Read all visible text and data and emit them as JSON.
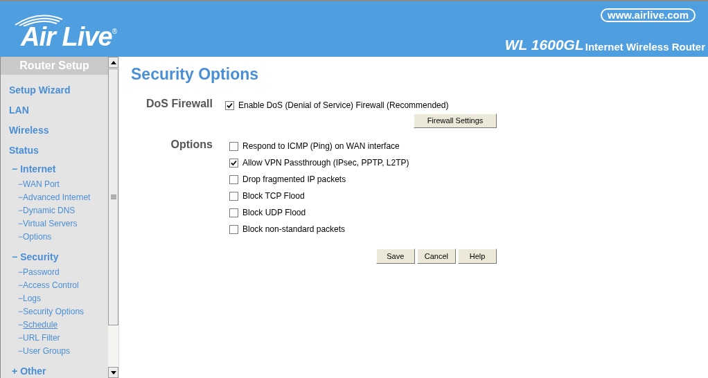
{
  "header": {
    "logo": "Air Live",
    "registered": "®",
    "website": "www.airlive.com",
    "model": "WL 1600GL",
    "product": "Internet Wireless Router"
  },
  "sidebar": {
    "title": "Router Setup",
    "items": [
      {
        "kind": "link",
        "label": "Setup Wizard"
      },
      {
        "kind": "link",
        "label": "LAN"
      },
      {
        "kind": "link",
        "label": "Wireless"
      },
      {
        "kind": "link",
        "label": "Status"
      },
      {
        "kind": "group",
        "toggle": "−",
        "label": "Internet",
        "children": [
          {
            "toggle": "−",
            "label": "WAN Port",
            "hovered": false
          },
          {
            "toggle": "−",
            "label": "Advanced Internet",
            "hovered": false
          },
          {
            "toggle": "−",
            "label": "Dynamic DNS",
            "hovered": false
          },
          {
            "toggle": "−",
            "label": "Virtual Servers",
            "hovered": false
          },
          {
            "toggle": "−",
            "label": "Options",
            "hovered": false
          }
        ]
      },
      {
        "kind": "group",
        "toggle": "−",
        "label": "Security",
        "children": [
          {
            "toggle": "−",
            "label": "Password",
            "hovered": false
          },
          {
            "toggle": "−",
            "label": "Access Control",
            "hovered": false
          },
          {
            "toggle": "−",
            "label": "Logs",
            "hovered": false
          },
          {
            "toggle": "−",
            "label": "Security Options",
            "hovered": false
          },
          {
            "toggle": "−",
            "label": "Schedule",
            "hovered": true
          },
          {
            "toggle": "−",
            "label": "URL Filter",
            "hovered": false
          },
          {
            "toggle": "−",
            "label": "User Groups",
            "hovered": false
          }
        ]
      },
      {
        "kind": "group",
        "toggle": "+",
        "label": "Other"
      }
    ]
  },
  "page": {
    "title": "Security Options",
    "sections": [
      {
        "label": "DoS Firewall",
        "options": [
          {
            "label": "Enable DoS (Denial of Service) Firewall (Recommended)",
            "checked": true
          }
        ],
        "button": "Firewall Settings"
      },
      {
        "label": "Options",
        "options": [
          {
            "label": "Respond to ICMP (Ping) on WAN interface",
            "checked": false
          },
          {
            "label": "Allow VPN Passthrough (IPsec, PPTP, L2TP)",
            "checked": true
          },
          {
            "label": "Drop fragmented IP packets",
            "checked": false
          },
          {
            "label": "Block TCP Flood",
            "checked": false
          },
          {
            "label": "Block UDP Flood",
            "checked": false
          },
          {
            "label": "Block non-standard packets",
            "checked": false
          }
        ]
      }
    ],
    "buttons": [
      "Save",
      "Cancel",
      "Help"
    ]
  }
}
